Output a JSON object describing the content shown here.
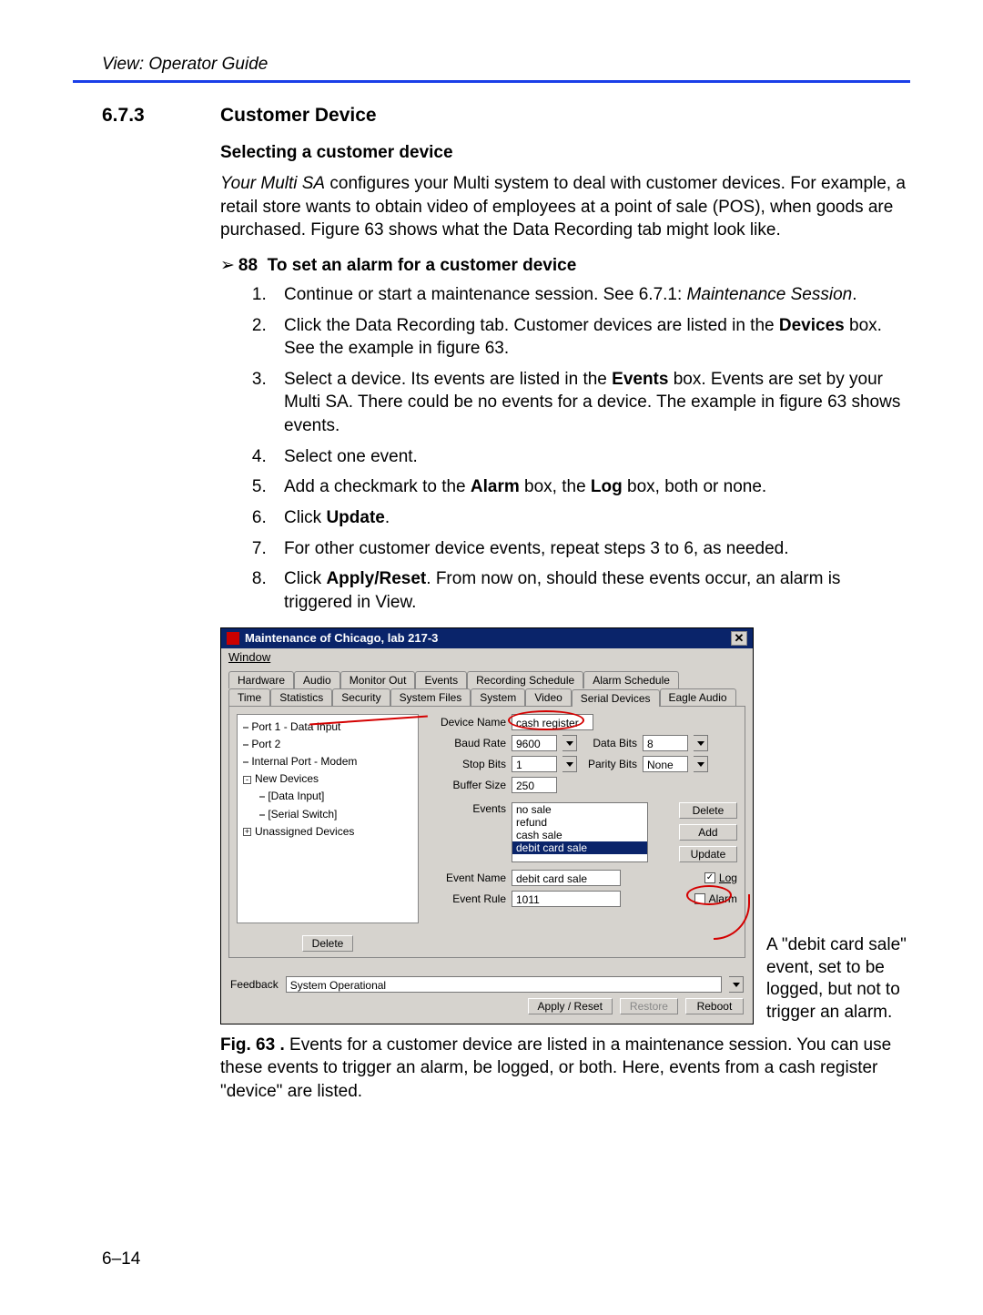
{
  "header": {
    "title": "View: Operator Guide"
  },
  "section": {
    "number": "6.7.3",
    "title": "Customer Device"
  },
  "subhead": "Selecting a customer device",
  "intro": {
    "lead_italic": "Your Multi SA",
    "rest": " configures your Multi system to deal with customer devices. For example, a retail store wants to obtain video of employees at a point of sale (POS), when goods are purchased. Figure 63 shows what the Data Recording tab might look like."
  },
  "procedure": {
    "arrow": "➢",
    "num": "88",
    "title": "To set an alarm for a customer device",
    "steps": [
      {
        "pre": "Continue or start a maintenance session. See 6.7.1: ",
        "ital": "Maintenance Session",
        "post": "."
      },
      {
        "pre": "Click the Data Recording tab. Customer devices are listed in the ",
        "b1": "Devices",
        "mid": " box. See the example in figure 63."
      },
      {
        "pre": "Select a device. Its events are listed in the ",
        "b1": "Events",
        "mid": " box. Events are set by your Multi SA. There could be no events for a device. The example in figure 63 shows events."
      },
      {
        "pre": "Select one event."
      },
      {
        "pre": "Add a checkmark to the ",
        "b1": "Alarm",
        "mid": " box, the ",
        "b2": "Log",
        "post": " box, both or none."
      },
      {
        "pre": "Click ",
        "b1": "Update",
        "mid": "."
      },
      {
        "pre": "For other customer device events, repeat steps 3 to 6, as needed."
      },
      {
        "pre": "Click ",
        "b1": "Apply/Reset",
        "mid": ". From now on, should these events occur, an alarm is triggered in View."
      }
    ]
  },
  "screenshot": {
    "title": "Maintenance of Chicago, lab 217-3",
    "menu": "Window",
    "tabs_row1": [
      "Hardware",
      "Audio",
      "Monitor Out",
      "Events",
      "Recording Schedule",
      "Alarm Schedule"
    ],
    "tabs_row2": [
      "Time",
      "Statistics",
      "Security",
      "System Files",
      "System",
      "Video",
      "Serial Devices",
      "Eagle Audio"
    ],
    "tree": [
      "Port 1 - Data Input",
      "Port 2",
      "Internal Port - Modem",
      "New Devices",
      "[Data Input]",
      "[Serial Switch]",
      "Unassigned Devices"
    ],
    "tree_delete": "Delete",
    "fields": {
      "device_name_label": "Device Name",
      "device_name": "cash register",
      "baud_label": "Baud Rate",
      "baud": "9600",
      "data_bits_label": "Data Bits",
      "data_bits": "8",
      "stop_bits_label": "Stop Bits",
      "stop_bits": "1",
      "parity_label": "Parity Bits",
      "parity": "None",
      "buffer_label": "Buffer Size",
      "buffer": "250",
      "events_label": "Events",
      "events": [
        "no sale",
        "refund",
        "cash sale",
        "debit card sale"
      ],
      "events_selected": "debit card sale",
      "delete": "Delete",
      "add": "Add",
      "update": "Update",
      "event_name_label": "Event Name",
      "event_name": "debit card sale",
      "event_rule_label": "Event Rule",
      "event_rule": "1011",
      "log_label": "Log",
      "alarm_label": "Alarm"
    },
    "feedback_label": "Feedback",
    "feedback": "System Operational",
    "apply": "Apply / Reset",
    "restore": "Restore",
    "reboot": "Reboot"
  },
  "annotation": "A \"debit card sale\" event, set to be logged, but not to trigger an alarm.",
  "caption": {
    "lead": "Fig. 63 .",
    "text": " Events for a customer device are listed in a maintenance session. You can use these events to trigger an alarm, be logged, or both. Here, events from a cash register \"device\" are listed."
  },
  "pagenum": "6–14"
}
